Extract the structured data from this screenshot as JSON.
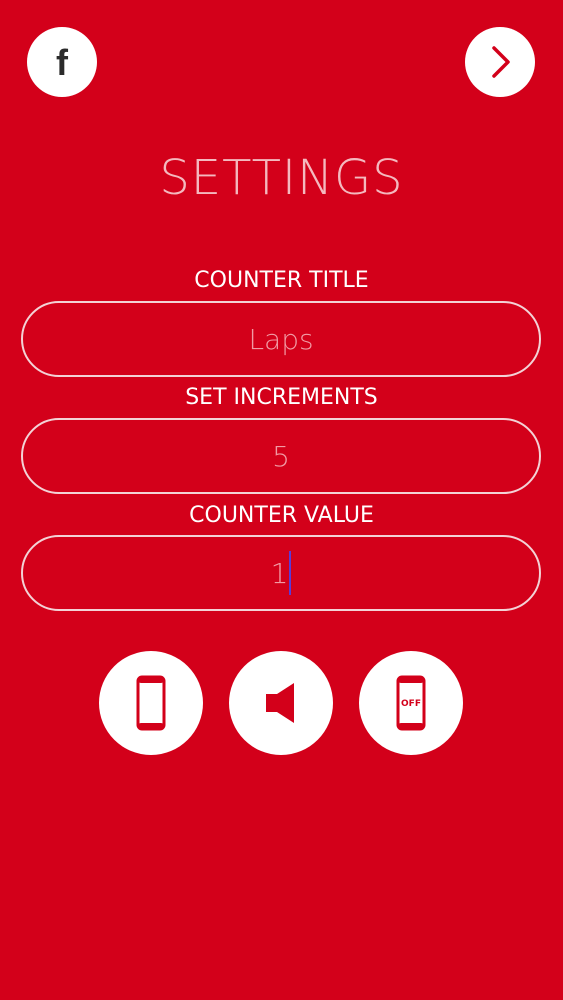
{
  "header": {
    "facebook_icon": "facebook-f-icon",
    "next_icon": "chevron-right-icon",
    "facebook_glyph": "f"
  },
  "page": {
    "title": "SETTINGS"
  },
  "fields": {
    "counter_title": {
      "label": "COUNTER TITLE",
      "value": "Laps"
    },
    "set_increments": {
      "label": "SET INCREMENTS",
      "value": "5"
    },
    "counter_value": {
      "label": "COUNTER VALUE",
      "value": "1"
    }
  },
  "actions": {
    "phone_icon": "phone-icon",
    "sound_icon": "speaker-icon",
    "screen_off_icon": "phone-off-icon",
    "screen_off_label": "OFF"
  },
  "colors": {
    "background": "#d3001a",
    "white": "#ffffff",
    "title_text": "#f4b9bf",
    "placeholder_text": "#f19aa4",
    "caret": "#5b3bd6"
  }
}
